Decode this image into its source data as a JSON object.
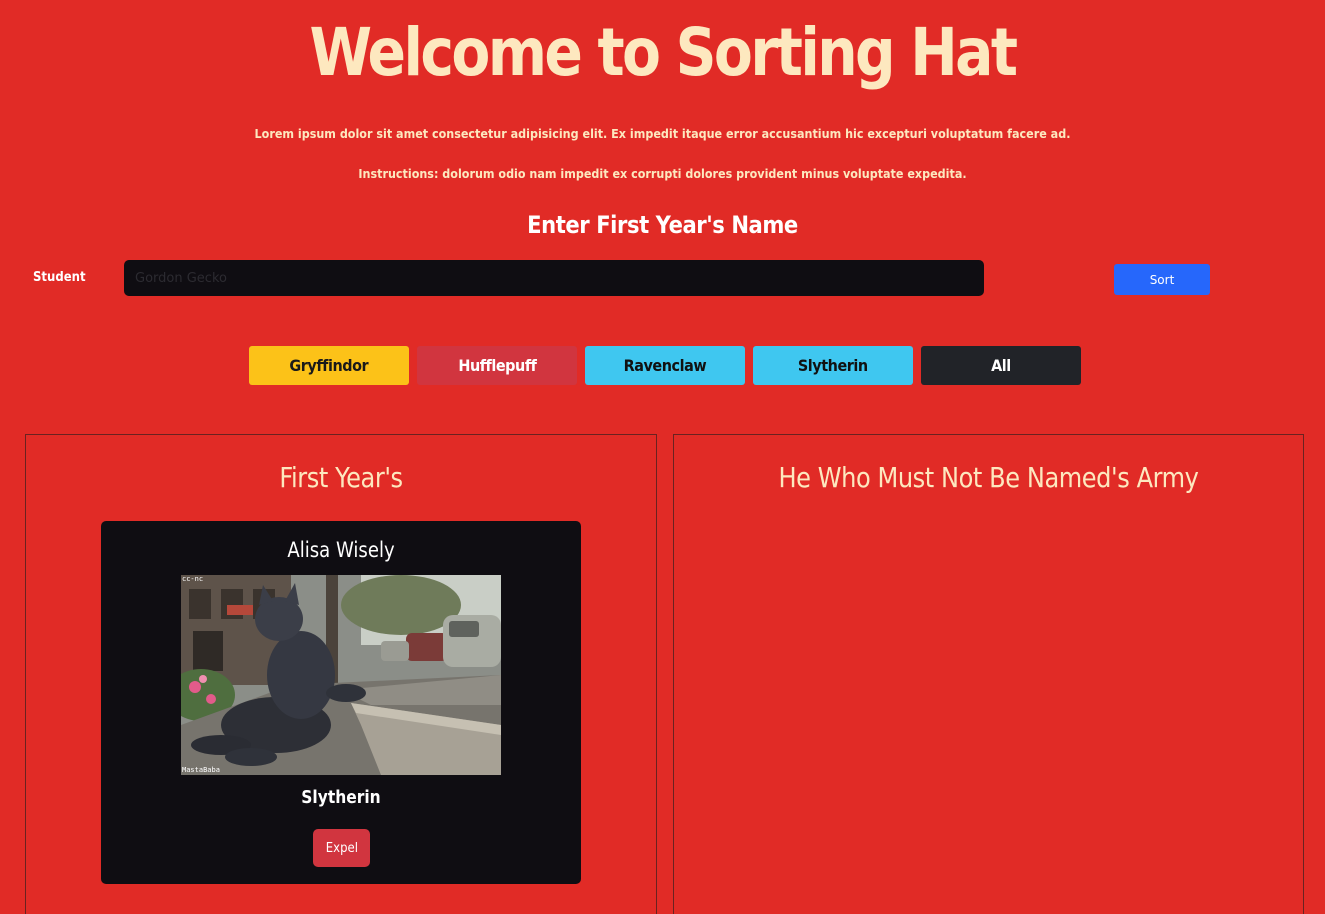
{
  "header": {
    "title": "Welcome to Sorting Hat",
    "intro": "Lorem ipsum dolor sit amet consectetur adipisicing elit. Ex impedit itaque error accusantium hic excepturi voluptatum facere ad.",
    "instructions": "Instructions: dolorum odio nam impedit ex corrupti dolores provident minus voluptate expedita."
  },
  "form": {
    "heading": "Enter First Year's Name",
    "student_label": "Student",
    "input_placeholder": "Gordon Gecko",
    "input_value": "",
    "sort_label": "Sort"
  },
  "filters": [
    {
      "label": "Gryffindor",
      "color": "#fcc218"
    },
    {
      "label": "Hufflepuff",
      "color": "#d1353f"
    },
    {
      "label": "Ravenclaw",
      "color": "#3fc7f0"
    },
    {
      "label": "Slytherin",
      "color": "#3fc7f0"
    },
    {
      "label": "All",
      "color": "#212328"
    }
  ],
  "panels": {
    "first_years": {
      "title": "First Year's",
      "cards": [
        {
          "name": "Alisa Wisely",
          "image_watermark_top": "cc-nc",
          "image_watermark_bottom": "MastaBaba",
          "house": "Slytherin",
          "expel_label": "Expel"
        }
      ]
    },
    "army": {
      "title": "He Who Must Not Be Named's Army"
    }
  },
  "colors": {
    "background": "#e12b26",
    "heading_text": "#fde8bf",
    "card_background": "#0f0d12",
    "sort_button": "#2667fb"
  }
}
